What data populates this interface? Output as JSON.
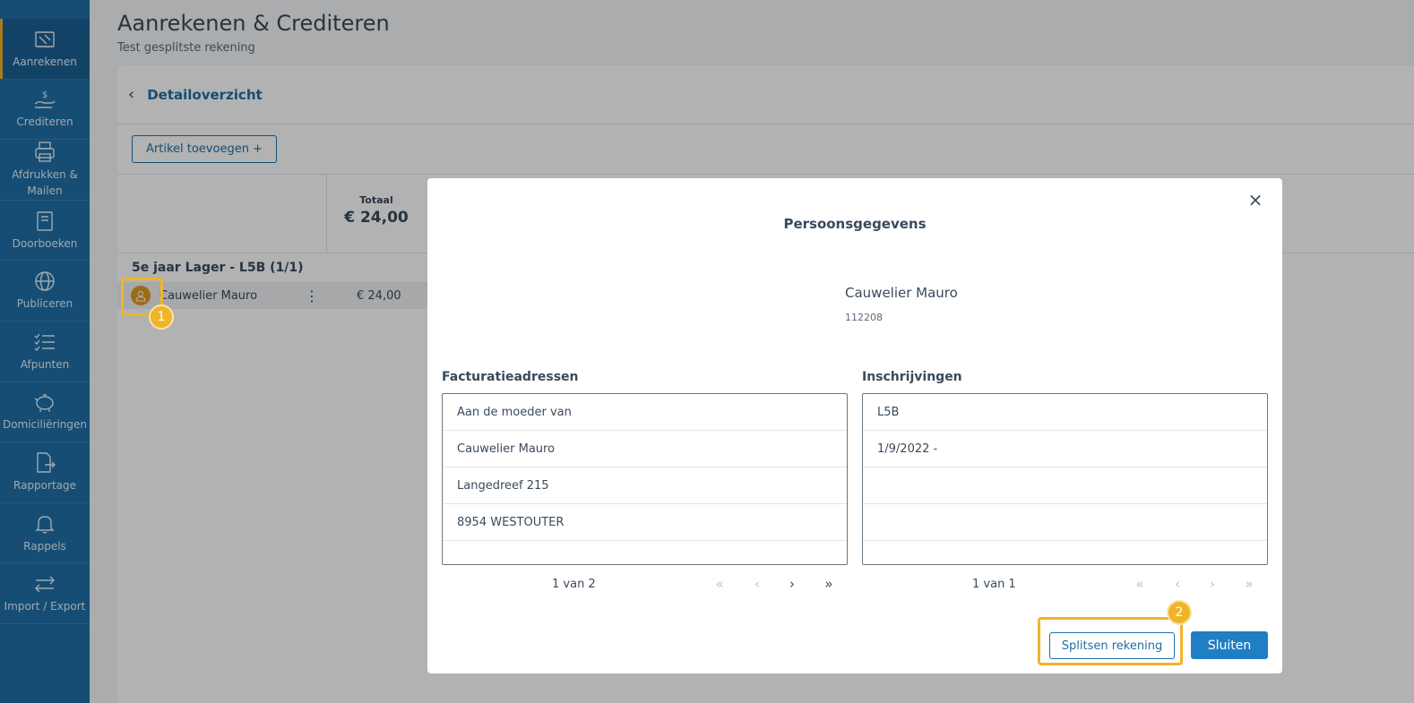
{
  "sidebar": {
    "items": [
      {
        "label": "Aanrekenen",
        "icon": "invoice-icon",
        "active": true
      },
      {
        "label": "Crediteren",
        "icon": "hand-money-icon"
      },
      {
        "label": "Afdrukken & Mailen",
        "icon": "printer-icon"
      },
      {
        "label": "Doorboeken",
        "icon": "book-icon"
      },
      {
        "label": "Publiceren",
        "icon": "globe-icon"
      },
      {
        "label": "Afpunten",
        "icon": "checklist-icon"
      },
      {
        "label": "Domiciliëringen",
        "icon": "piggy-bank-icon"
      },
      {
        "label": "Rapportage",
        "icon": "report-export-icon"
      },
      {
        "label": "Rappels",
        "icon": "bell-icon"
      },
      {
        "label": "Import / Export",
        "icon": "arrows-exchange-icon"
      }
    ]
  },
  "header": {
    "title": "Aanrekenen & Crediteren",
    "subtitle": "Test gesplitste rekening"
  },
  "detail": {
    "title": "Detailoverzicht",
    "add_article_label": "Artikel toevoegen +",
    "total_label": "Totaal",
    "total_value": "€ 24,00",
    "group_title": "5e jaar Lager - L5B (1/1)",
    "person_name": "Cauwelier Mauro",
    "person_amount": "€ 24,00"
  },
  "modal": {
    "title": "Persoonsgegevens",
    "close_icon": "×",
    "person_name": "Cauwelier Mauro",
    "person_id": "112208",
    "billing": {
      "title": "Facturatieadressen",
      "rows": [
        "Aan de moeder van",
        "Cauwelier Mauro",
        "Langedreef 215",
        "8954 WESTOUTER",
        ""
      ],
      "pager_text": "1 van 2"
    },
    "enrollments": {
      "title": "Inschrijvingen",
      "rows": [
        "L5B",
        "1/9/2022 -",
        "",
        "",
        ""
      ],
      "pager_text": "1 van 1"
    },
    "split_label": "Splitsen rekening",
    "close_label": "Sluiten"
  },
  "annotations": {
    "badge1": "1",
    "badge2": "2"
  },
  "colors": {
    "sidebar": "#1f6fa7",
    "accent": "#f0b429",
    "primary_button": "#1f7fc4"
  }
}
